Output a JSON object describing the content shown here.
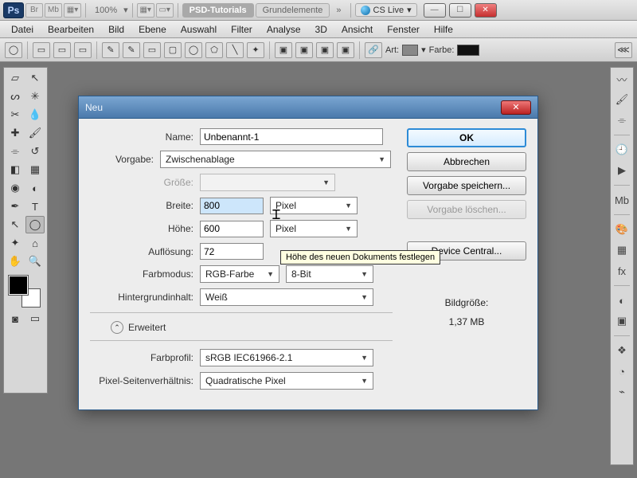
{
  "appbar": {
    "ps": "Ps",
    "br": "Br",
    "mb": "Mb",
    "zoom": "100%",
    "tab_active": "PSD-Tutorials",
    "tab_inactive": "Grundelemente",
    "overflow": "»",
    "cslive": "CS Live"
  },
  "menu": {
    "items": [
      "Datei",
      "Bearbeiten",
      "Bild",
      "Ebene",
      "Auswahl",
      "Filter",
      "Analyse",
      "3D",
      "Ansicht",
      "Fenster",
      "Hilfe"
    ]
  },
  "optbar": {
    "art": "Art:",
    "farbe": "Farbe:"
  },
  "dialog": {
    "title": "Neu",
    "name_label": "Name:",
    "name_value": "Unbenannt-1",
    "preset_label": "Vorgabe:",
    "preset_value": "Zwischenablage",
    "size_label": "Größe:",
    "width_label": "Breite:",
    "width_value": "800",
    "width_unit": "Pixel",
    "height_label": "Höhe:",
    "height_value": "600",
    "height_unit": "Pixel",
    "res_label": "Auflösung:",
    "res_value": "72",
    "mode_label": "Farbmodus:",
    "mode_value": "RGB-Farbe",
    "depth_value": "8-Bit",
    "bg_label": "Hintergrundinhalt:",
    "bg_value": "Weiß",
    "advanced": "Erweitert",
    "profile_label": "Farbprofil:",
    "profile_value": "sRGB IEC61966-2.1",
    "aspect_label": "Pixel-Seitenverhältnis:",
    "aspect_value": "Quadratische Pixel",
    "ok": "OK",
    "cancel": "Abbrechen",
    "save_preset": "Vorgabe speichern...",
    "del_preset": "Vorgabe löschen...",
    "device_central": "Device Central...",
    "filesize_label": "Bildgröße:",
    "filesize": "1,37 MB",
    "tooltip": "Höhe des neuen Dokuments festlegen"
  }
}
